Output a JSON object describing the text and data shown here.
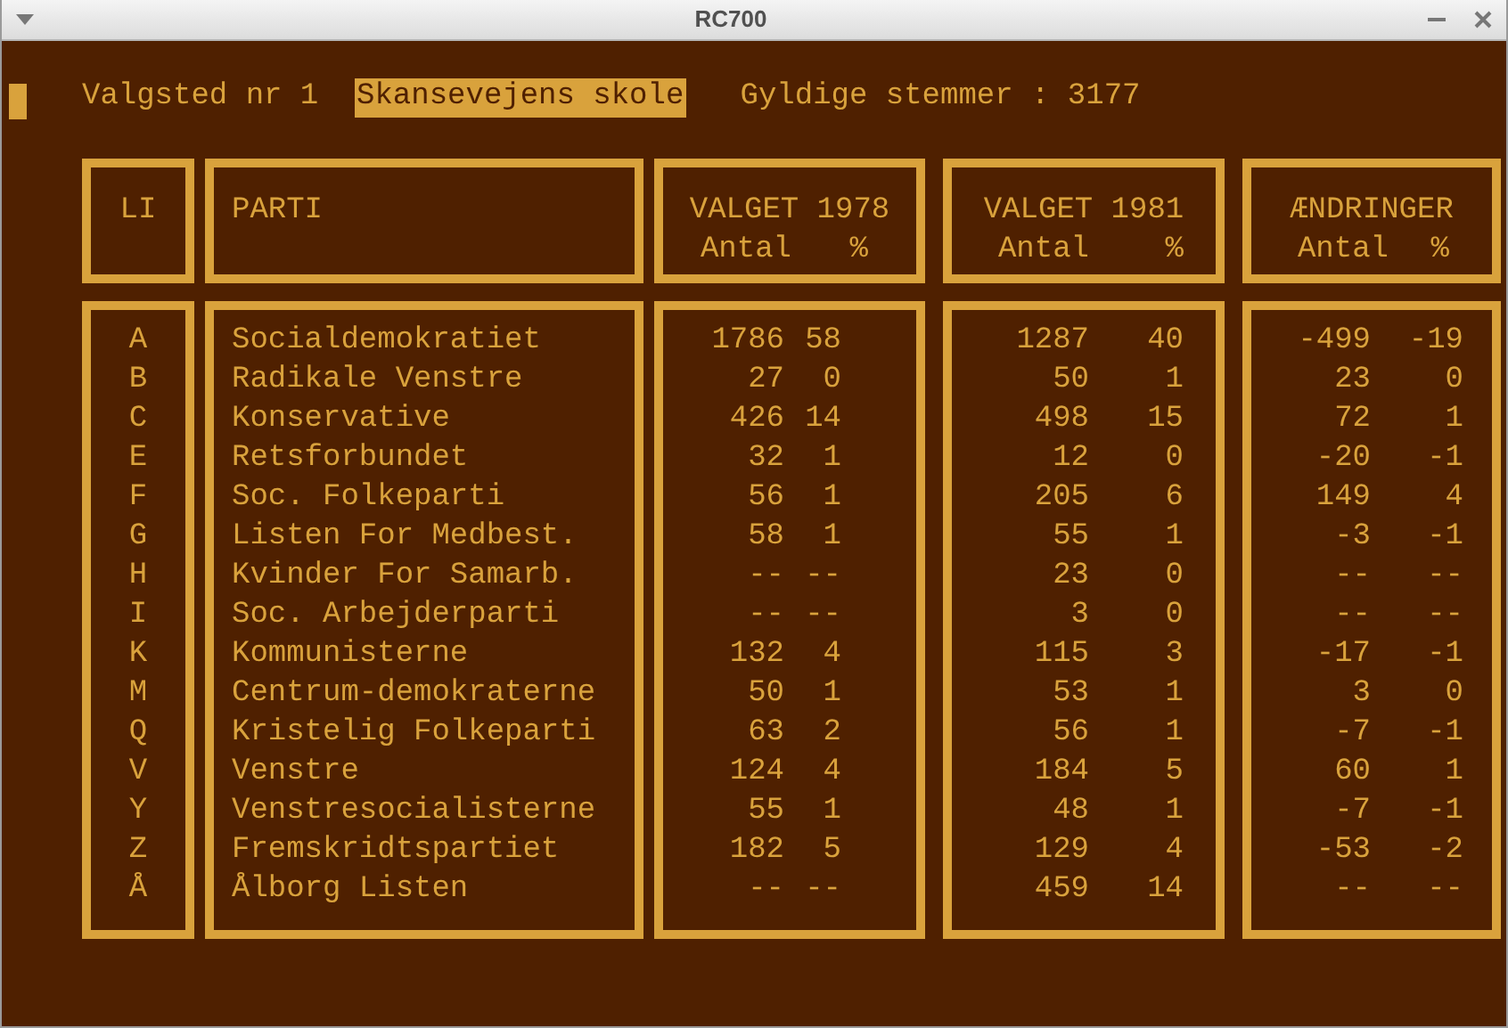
{
  "window": {
    "title": "RC700"
  },
  "header": {
    "station": "Valgsted nr 1",
    "school": "Skansevejens skole",
    "valid_votes": "Gyldige stemmer : 3177"
  },
  "columns": [
    {
      "title": "LI"
    },
    {
      "title": "PARTI"
    },
    {
      "title": "VALGET 1978",
      "sub": [
        "Antal",
        "%"
      ]
    },
    {
      "title": "VALGET 1981",
      "sub": [
        "Antal",
        "%"
      ]
    },
    {
      "title": "ÆNDRINGER",
      "sub": [
        "Antal",
        "%"
      ]
    }
  ],
  "rows": [
    {
      "list": "A",
      "party": "Socialdemokratiet",
      "v1978": [
        "1786",
        "58"
      ],
      "v1981": [
        "1287",
        "40"
      ],
      "change": [
        "-499",
        "-19"
      ]
    },
    {
      "list": "B",
      "party": "Radikale Venstre",
      "v1978": [
        "27",
        "0"
      ],
      "v1981": [
        "50",
        "1"
      ],
      "change": [
        "23",
        "0"
      ]
    },
    {
      "list": "C",
      "party": "Konservative",
      "v1978": [
        "426",
        "14"
      ],
      "v1981": [
        "498",
        "15"
      ],
      "change": [
        "72",
        "1"
      ]
    },
    {
      "list": "E",
      "party": "Retsforbundet",
      "v1978": [
        "32",
        "1"
      ],
      "v1981": [
        "12",
        "0"
      ],
      "change": [
        "-20",
        "-1"
      ]
    },
    {
      "list": "F",
      "party": "Soc. Folkeparti",
      "v1978": [
        "56",
        "1"
      ],
      "v1981": [
        "205",
        "6"
      ],
      "change": [
        "149",
        "4"
      ]
    },
    {
      "list": "G",
      "party": "Listen For Medbest.",
      "v1978": [
        "58",
        "1"
      ],
      "v1981": [
        "55",
        "1"
      ],
      "change": [
        "-3",
        "-1"
      ]
    },
    {
      "list": "H",
      "party": "Kvinder For Samarb.",
      "v1978": [
        "--",
        "--"
      ],
      "v1981": [
        "23",
        "0"
      ],
      "change": [
        "--",
        "--"
      ]
    },
    {
      "list": "I",
      "party": "Soc. Arbejderparti",
      "v1978": [
        "--",
        "--"
      ],
      "v1981": [
        "3",
        "0"
      ],
      "change": [
        "--",
        "--"
      ]
    },
    {
      "list": "K",
      "party": "Kommunisterne",
      "v1978": [
        "132",
        "4"
      ],
      "v1981": [
        "115",
        "3"
      ],
      "change": [
        "-17",
        "-1"
      ]
    },
    {
      "list": "M",
      "party": "Centrum-demokraterne",
      "v1978": [
        "50",
        "1"
      ],
      "v1981": [
        "53",
        "1"
      ],
      "change": [
        "3",
        "0"
      ]
    },
    {
      "list": "Q",
      "party": "Kristelig Folkeparti",
      "v1978": [
        "63",
        "2"
      ],
      "v1981": [
        "56",
        "1"
      ],
      "change": [
        "-7",
        "-1"
      ]
    },
    {
      "list": "V",
      "party": "Venstre",
      "v1978": [
        "124",
        "4"
      ],
      "v1981": [
        "184",
        "5"
      ],
      "change": [
        "60",
        "1"
      ]
    },
    {
      "list": "Y",
      "party": "Venstresocialisterne",
      "v1978": [
        "55",
        "1"
      ],
      "v1981": [
        "48",
        "1"
      ],
      "change": [
        "-7",
        "-1"
      ]
    },
    {
      "list": "Z",
      "party": "Fremskridtspartiet",
      "v1978": [
        "182",
        "5"
      ],
      "v1981": [
        "129",
        "4"
      ],
      "change": [
        "-53",
        "-2"
      ]
    },
    {
      "list": "Å",
      "party": "Ålborg Listen",
      "v1978": [
        "--",
        "--"
      ],
      "v1981": [
        "459",
        "14"
      ],
      "change": [
        "--",
        "--"
      ]
    }
  ]
}
